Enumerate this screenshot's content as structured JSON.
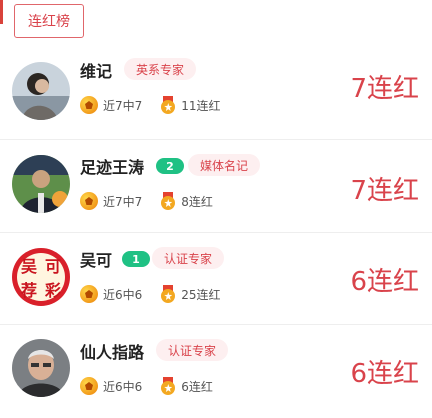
{
  "tab": {
    "label": "连红榜"
  },
  "experts": [
    {
      "name": "维记",
      "level_badge": "",
      "tag": "英系专家",
      "recent": "近7中7",
      "streak_count": "11连红",
      "big_streak": "7连红"
    },
    {
      "name": "足迹王涛",
      "level_badge": "2",
      "tag": "媒体名记",
      "recent": "近7中7",
      "streak_count": "8连红",
      "big_streak": "7连红"
    },
    {
      "name": "吴可",
      "level_badge": "1",
      "tag": "认证专家",
      "recent": "近6中6",
      "streak_count": "25连红",
      "big_streak": "6连红"
    },
    {
      "name": "仙人指路",
      "level_badge": "",
      "tag": "认证专家",
      "recent": "近6中6",
      "streak_count": "6连红",
      "big_streak": "6连红"
    }
  ],
  "avatar4_text": [
    "吴",
    "可",
    "荐",
    "彩"
  ],
  "colors": {
    "accent": "#d9434b",
    "tag_bg": "#fdeff0",
    "level_green": "#1fc184"
  },
  "icons": [
    "football-icon",
    "medal-icon"
  ]
}
